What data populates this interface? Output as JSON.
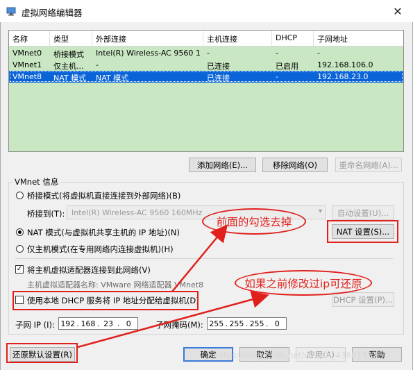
{
  "window": {
    "title": "虚拟网络编辑器",
    "close_glyph": "✕"
  },
  "table": {
    "columns": [
      "名称",
      "类型",
      "外部连接",
      "主机连接",
      "DHCP",
      "子网地址"
    ],
    "rows": [
      {
        "name": "VMnet0",
        "type": "桥接模式",
        "external": "Intel(R) Wireless-AC 9560 1...",
        "host": "-",
        "dhcp": "-",
        "subnet": "-"
      },
      {
        "name": "VMnet1",
        "type": "仅主机...",
        "external": "-",
        "host": "已连接",
        "dhcp": "已启用",
        "subnet": "192.168.106.0"
      },
      {
        "name": "VMnet8",
        "type": "NAT 模式",
        "external": "NAT 模式",
        "host": "已连接",
        "dhcp": "-",
        "subnet": "192.168.23.0"
      }
    ],
    "selected_row": "VMnet8"
  },
  "table_buttons": {
    "add": "添加网络(E)...",
    "remove": "移除网络(O)",
    "rename": "重命名网络(A)..."
  },
  "vmnet_info": {
    "group_label": "VMnet 信息",
    "bridge_mode": "桥接模式(将虚拟机直接连接到外部网络)(B)",
    "bridge_to_label": "桥接到(T):",
    "bridge_to_value": "Intel(R) Wireless-AC 9560 160MHz",
    "auto_settings": "自动设置(U)...",
    "nat_mode": "NAT 模式(与虚拟机共享主机的 IP 地址)(N)",
    "nat_settings": "NAT 设置(S)...",
    "host_only_mode": "仅主机模式(在专用网络内连接虚拟机)(H)",
    "connect_adapter": "将主机虚拟适配器连接到此网络(V)",
    "adapter_name": "主机虚拟适配器名称: VMware 网络适配器 VMnet8",
    "use_dhcp": "使用本地 DHCP 服务将 IP 地址分配给虚拟机(D)",
    "dhcp_settings": "DHCP 设置(P)...",
    "subnet_ip_label": "子网 IP (I):",
    "subnet_ip": [
      "192",
      "168",
      "23",
      "0"
    ],
    "subnet_mask_label": "子网掩码(M):",
    "subnet_mask": [
      "255",
      "255",
      "255",
      "0"
    ]
  },
  "footer": {
    "restore": "还原默认设置(R)",
    "ok": "确定",
    "cancel": "取消",
    "apply": "应用(A)",
    "help": "帮助"
  },
  "annotations": {
    "note1": "前面的勾选去掉",
    "note2": "如果之前修改过ip可还原",
    "red": "#e0201c"
  },
  "watermark": "https://blog.csdn.net/weixin_43681337"
}
